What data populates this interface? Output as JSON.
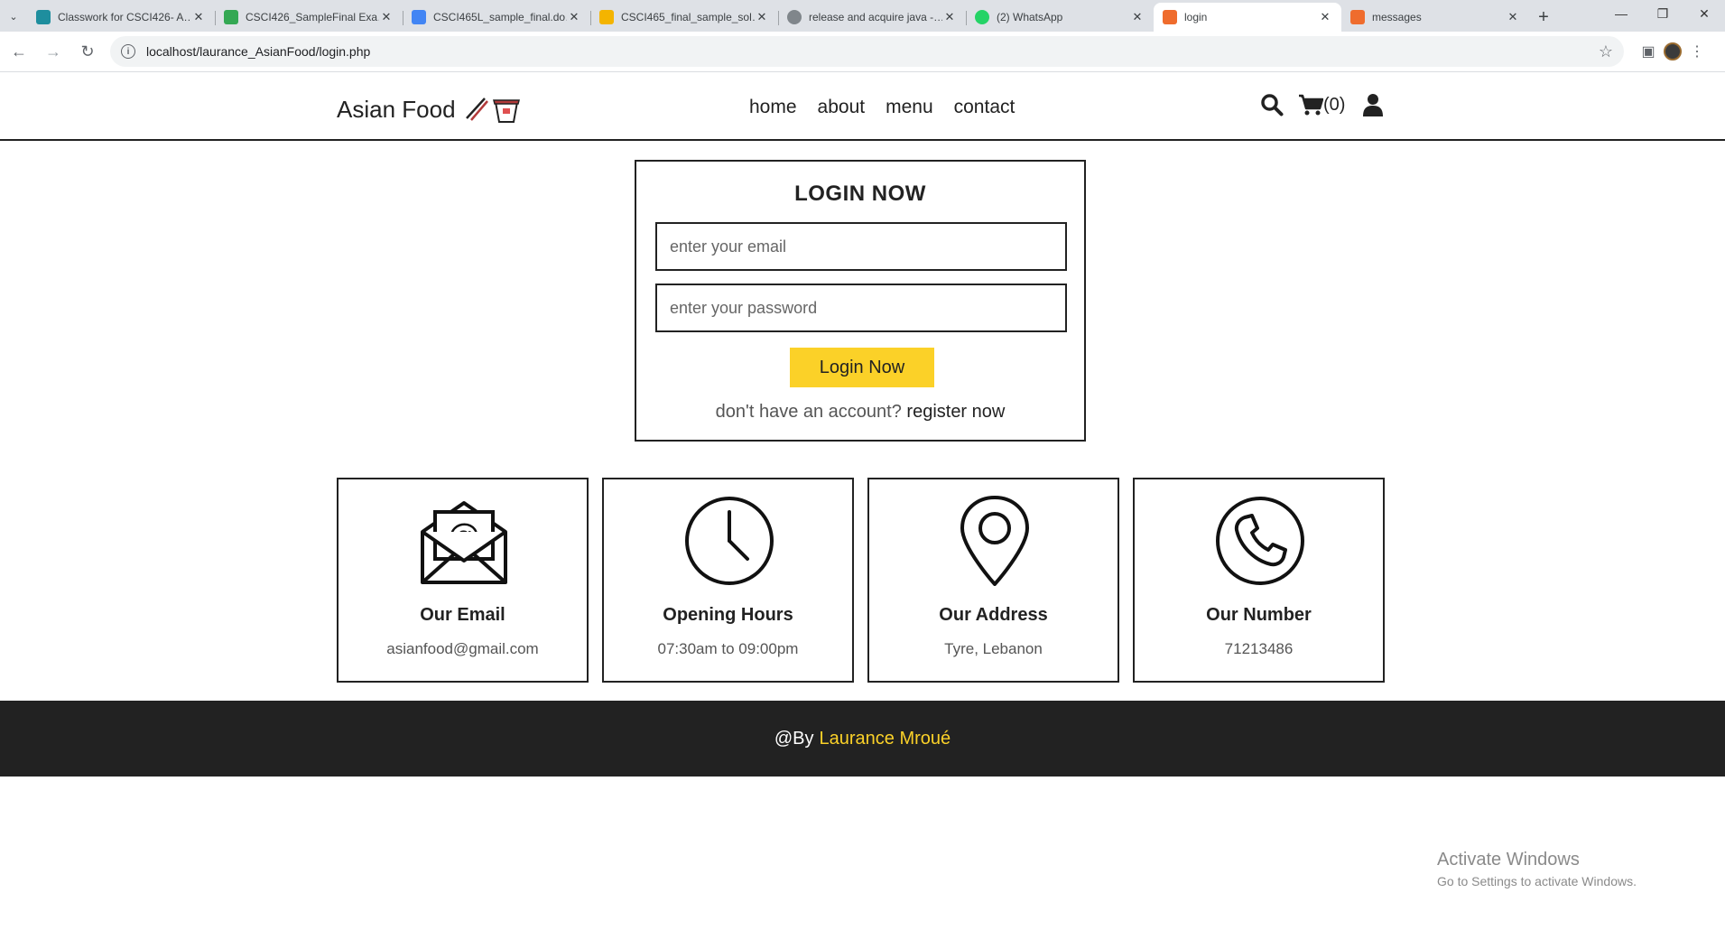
{
  "browser": {
    "tabs": [
      {
        "title": "Classwork for CSCI426- A…",
        "favicon_color": "#1e8e9e",
        "favicon": "classroom-icon"
      },
      {
        "title": "CSCI426_SampleFinal Exa…",
        "favicon_color": "#34a853",
        "favicon": "drive-icon"
      },
      {
        "title": "CSCI465L_sample_final.do…",
        "favicon_color": "#4285f4",
        "favicon": "drive-icon"
      },
      {
        "title": "CSCI465_final_sample_sol…",
        "favicon_color": "#f4b400",
        "favicon": "slides-icon"
      },
      {
        "title": "release and acquire java -…",
        "favicon_color": "#80868b",
        "favicon": "globe-icon"
      },
      {
        "title": "(2) WhatsApp",
        "favicon_color": "#25d366",
        "favicon": "whatsapp-icon"
      },
      {
        "title": "login",
        "favicon_color": "#ef6c2d",
        "favicon": "xampp-icon"
      },
      {
        "title": "messages",
        "favicon_color": "#ef6c2d",
        "favicon": "xampp-icon"
      }
    ],
    "active_tab_index": 6,
    "url": "localhost/laurance_AsianFood/login.php"
  },
  "header": {
    "logo_text": "Asian Food",
    "nav": [
      "home",
      "about",
      "menu",
      "contact"
    ],
    "cart_count": "(0)"
  },
  "login": {
    "title": "LOGIN NOW",
    "email_placeholder": "enter your email",
    "password_placeholder": "enter your password",
    "button": "Login Now",
    "register_prompt": "don't have an account?",
    "register_link": "register now"
  },
  "info_cards": [
    {
      "icon": "email-icon",
      "title": "Our Email",
      "value": "asianfood@gmail.com"
    },
    {
      "icon": "clock-icon",
      "title": "Opening Hours",
      "value": "07:30am to 09:00pm"
    },
    {
      "icon": "location-pin-icon",
      "title": "Our Address",
      "value": "Tyre, Lebanon"
    },
    {
      "icon": "phone-icon",
      "title": "Our Number",
      "value": "71213486"
    }
  ],
  "footer": {
    "prefix": "@By",
    "author": "Laurance Mroué"
  },
  "windows_watermark": {
    "line1": "Activate Windows",
    "line2": "Go to Settings to activate Windows."
  },
  "colors": {
    "accent": "#fbd128",
    "dark": "#222222"
  }
}
